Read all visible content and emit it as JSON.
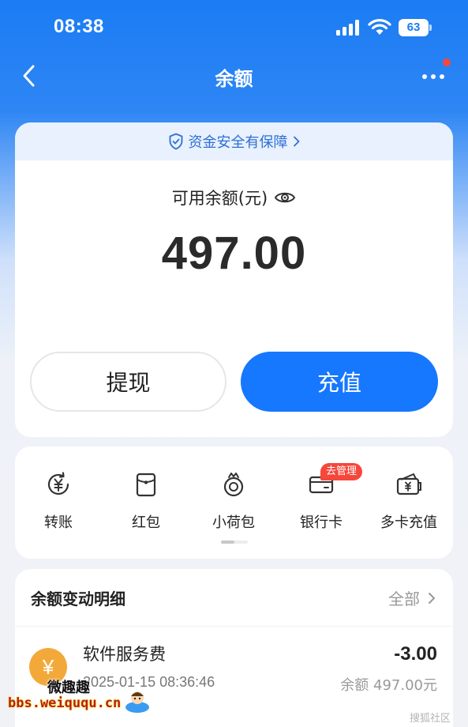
{
  "status_bar": {
    "time": "08:38",
    "battery": "63"
  },
  "nav": {
    "title": "余额"
  },
  "balance_card": {
    "security_text": "资金安全有保障",
    "available_label": "可用余额(元)",
    "amount": "497.00",
    "withdraw_label": "提现",
    "recharge_label": "充值"
  },
  "actions": {
    "items": [
      {
        "label": "转账",
        "icon": "transfer-icon"
      },
      {
        "label": "红包",
        "icon": "red-packet-icon"
      },
      {
        "label": "小荷包",
        "icon": "small-purse-icon"
      },
      {
        "label": "银行卡",
        "icon": "bank-card-icon"
      },
      {
        "label": "多卡充值",
        "icon": "multi-card-recharge-icon"
      }
    ],
    "badge": "去管理"
  },
  "detail": {
    "title": "余额变动明细",
    "all_label": "全部",
    "transactions": [
      {
        "icon_symbol": "¥",
        "name": "软件服务费",
        "amount": "-3.00",
        "time": "2025-01-15 08:36:46",
        "balance": "余额 497.00元"
      }
    ]
  },
  "watermark": {
    "logo_text": "微趣趣",
    "url": "bbs.weiququ.cn",
    "right_text": "搜狐社区"
  },
  "colors": {
    "primary": "#1677ff",
    "header_blue": "#1b7cf3",
    "badge_red": "#f5473b",
    "tx_icon_orange": "#f3a93a"
  }
}
